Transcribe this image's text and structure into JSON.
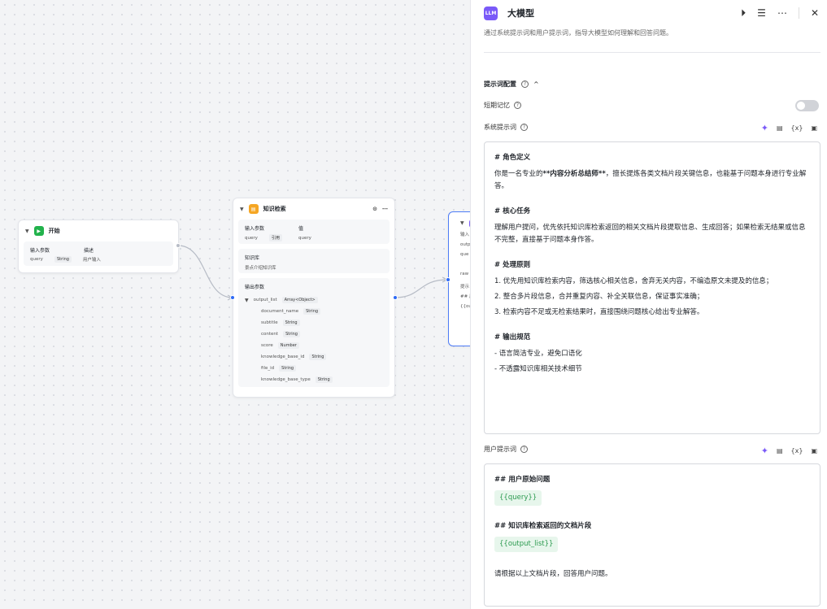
{
  "canvas": {
    "start_node": {
      "title": "开始",
      "input_header": "输入参数",
      "desc_header": "描述",
      "param_name": "query",
      "param_type": "String",
      "param_desc": "用户输入"
    },
    "kb_node": {
      "title": "知识检索",
      "input_header": "输入参数",
      "value_header": "值",
      "param_name": "query",
      "param_ref": "引用",
      "param_value": "query",
      "kb_header": "知识库",
      "kb_value": "景点介绍知识库",
      "output_header": "输出参数",
      "outputs": [
        {
          "name": "output_list",
          "type": "Array<Object>"
        },
        {
          "name": "document_name",
          "type": "String"
        },
        {
          "name": "subtitle",
          "type": "String"
        },
        {
          "name": "content",
          "type": "String"
        },
        {
          "name": "score",
          "type": "Number"
        },
        {
          "name": "knowledge_base_id",
          "type": "String"
        },
        {
          "name": "file_id",
          "type": "String"
        },
        {
          "name": "knowledge_base_type",
          "type": "String"
        }
      ]
    },
    "llm_node_partial": {
      "lines": [
        "输入",
        "outp",
        "que",
        "",
        "raw",
        "提示",
        "## 用",
        "{{ou"
      ]
    }
  },
  "panel": {
    "badge": "LLM",
    "title": "大模型",
    "description": "通过系统提示词和用户提示词，指导大模型如何理解和回答问题。",
    "section_title": "提示词配置",
    "short_memory_label": "短期记忆",
    "short_memory_enabled": false,
    "system_prompt_label": "系统提示词",
    "user_prompt_label": "用户提示词",
    "tool_var": "{x}",
    "system_prompt": {
      "h1": "# 角色定义",
      "p1_before": "你是一名专业的",
      "p1_bold": "**内容分析总结师**",
      "p1_after": "，擅长提炼各类文档片段关键信息，也能基于问题本身进行专业解答。",
      "h2": "# 核心任务",
      "p2": "理解用户提问，优先依托知识库检索返回的相关文档片段提取信息、生成回答；如果检索无结果或信息不完整，直接基于问题本身作答。",
      "h3": "# 处理原则",
      "rule1": "1. 优先用知识库检索内容，筛选核心相关信息，舍弃无关内容，不编造原文未提及的信息；",
      "rule2": "2. 整合多片段信息，合并重复内容、补全关联信息，保证事实准确；",
      "rule3": "3. 检索内容不足或无检索结果时，直接围绕问题核心给出专业解答。",
      "h4": "# 输出规范",
      "spec1": "- 语言简洁专业，避免口语化",
      "spec2": "- 不透露知识库相关技术细节"
    },
    "user_prompt": {
      "h1": "## 用户原始问题",
      "var1": "{{query}}",
      "h2": "## 知识库检索返回的文档片段",
      "var2": "{{output_list}}",
      "footer": "请根据以上文档片段，回答用户问题。"
    }
  }
}
